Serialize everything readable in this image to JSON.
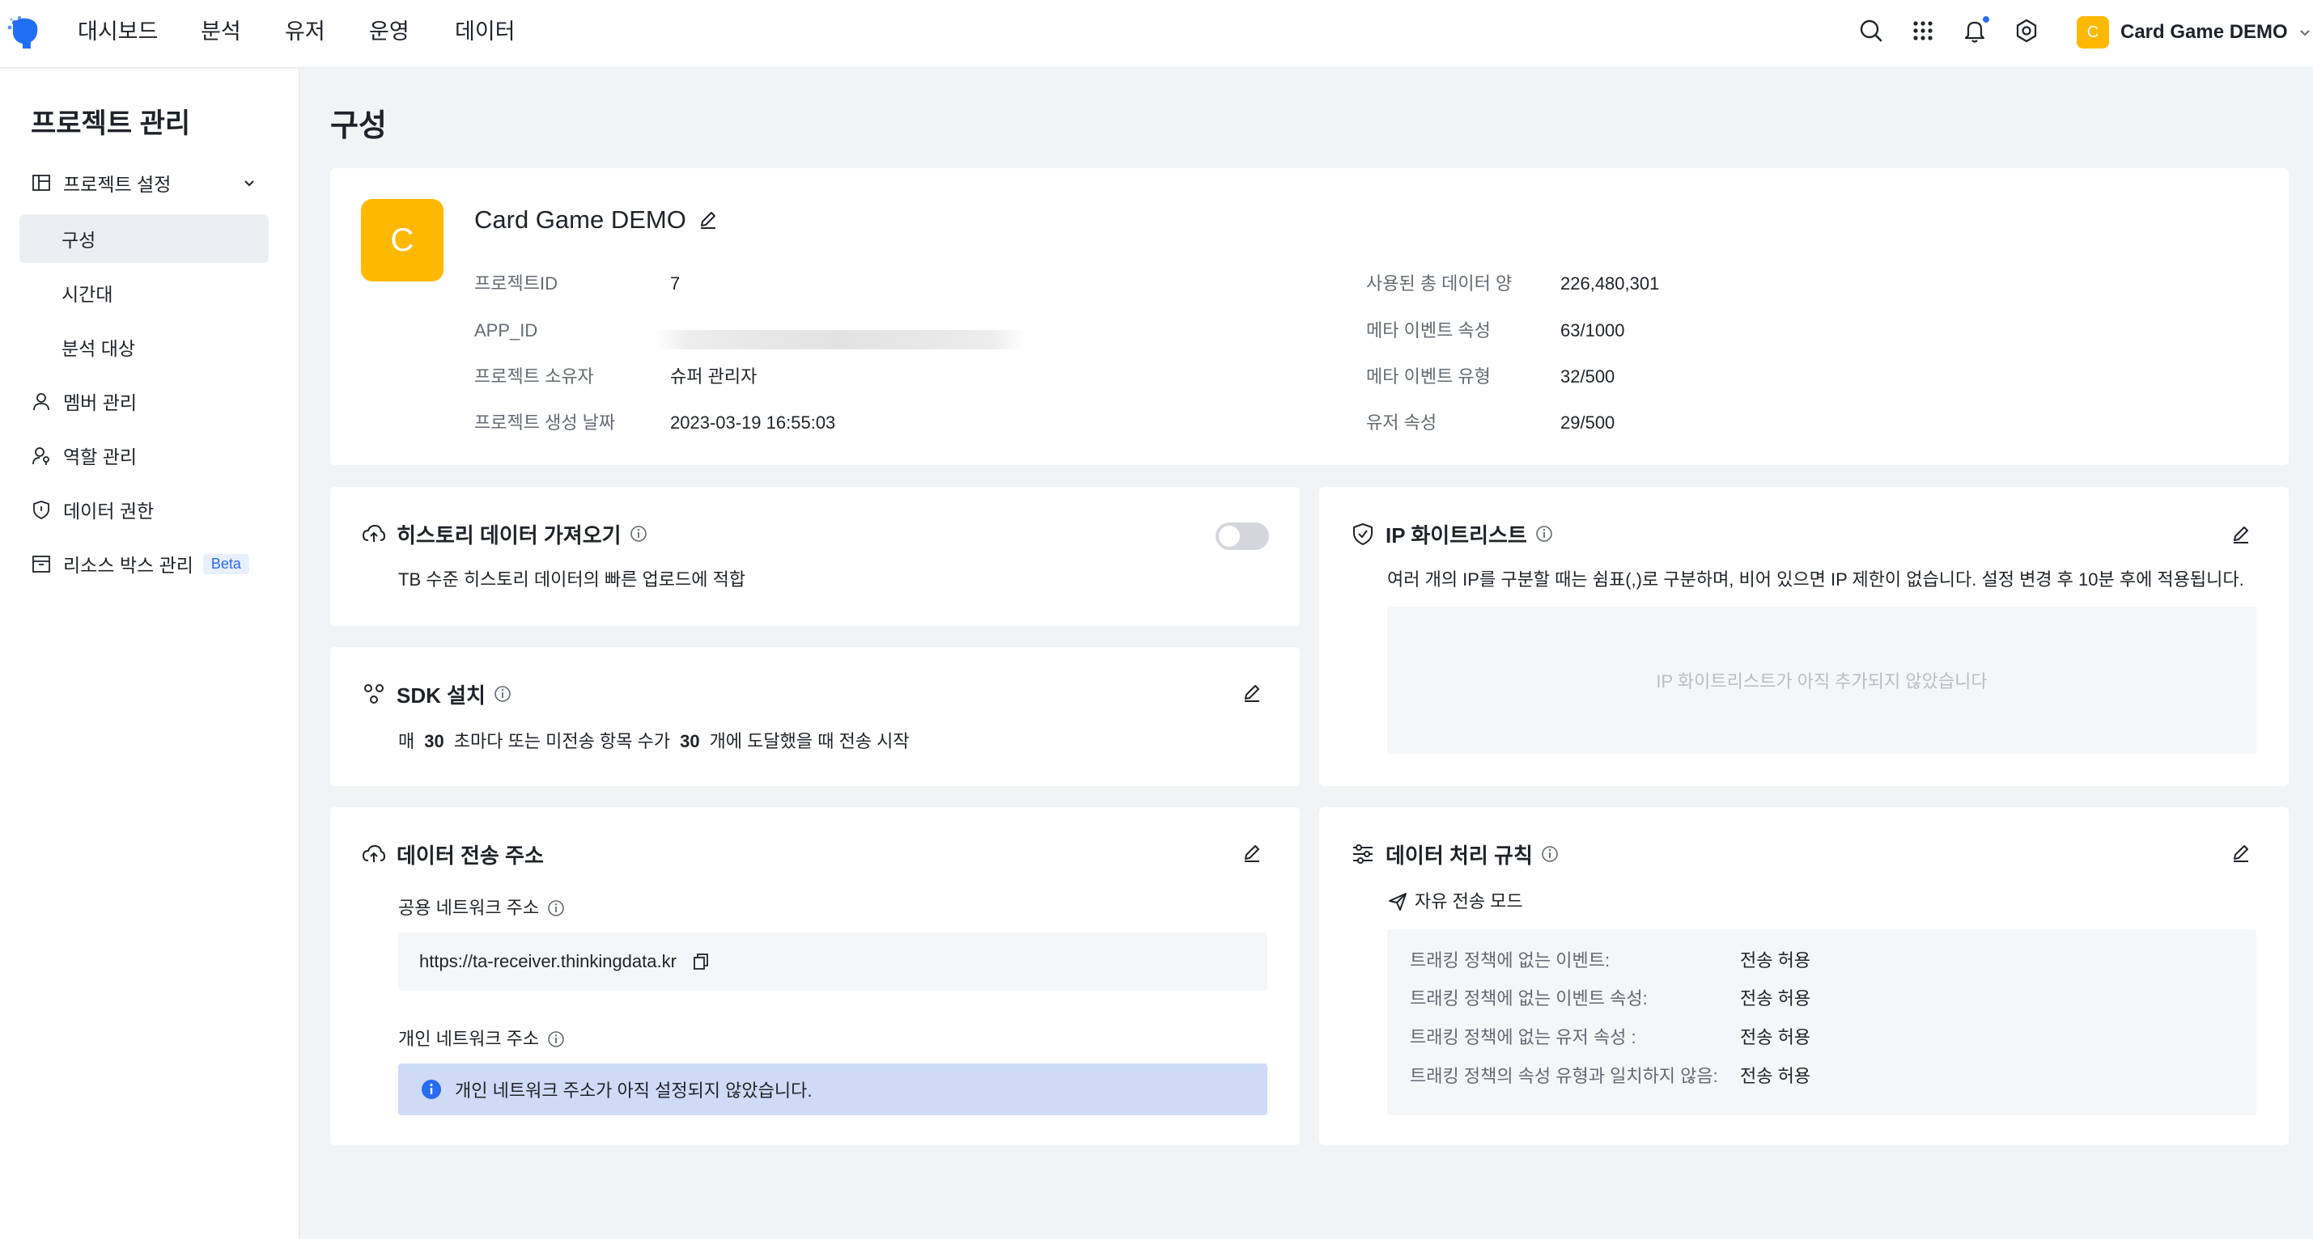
{
  "nav": {
    "items": [
      "대시보드",
      "분석",
      "유저",
      "운영",
      "데이터"
    ],
    "project_badge": "C",
    "project_name": "Card Game DEMO",
    "icons": [
      "search-icon",
      "apps-grid-icon",
      "bell-icon",
      "settings-icon"
    ]
  },
  "sidebar": {
    "title": "프로젝트 관리",
    "items": [
      {
        "label": "프로젝트 설정",
        "icon": "layout-icon"
      },
      {
        "label": "구성"
      },
      {
        "label": "시간대"
      },
      {
        "label": "분석 대상"
      },
      {
        "label": "멤버 관리",
        "icon": "user-icon"
      },
      {
        "label": "역할 관리",
        "icon": "user-key-icon"
      },
      {
        "label": "데이터 권한",
        "icon": "shield-icon"
      },
      {
        "label": "리소스 박스 관리",
        "icon": "box-icon",
        "badge": "Beta"
      }
    ]
  },
  "page": {
    "title": "구성"
  },
  "project": {
    "avatar": "C",
    "name": "Card Game DEMO",
    "left": [
      {
        "label": "프로젝트ID",
        "value": "7"
      },
      {
        "label": "APP_ID",
        "value": ""
      },
      {
        "label": "프로젝트 소유자",
        "value": "슈퍼 관리자"
      },
      {
        "label": "프로젝트 생성 날짜",
        "value": "2023-03-19 16:55:03"
      }
    ],
    "right": [
      {
        "label": "사용된 총 데이터 양",
        "value": "226,480,301"
      },
      {
        "label": "메타 이벤트 속성",
        "value": "63/1000"
      },
      {
        "label": "메타 이벤트 유형",
        "value": "32/500"
      },
      {
        "label": "유저 속성",
        "value": "29/500"
      }
    ]
  },
  "history": {
    "title": "히스토리 데이터 가져오기",
    "desc": "TB 수준 히스토리 데이터의 빠른 업로드에 적합",
    "enabled": false
  },
  "sdk": {
    "title": "SDK 설치",
    "text_1": "매",
    "interval": "30",
    "text_2": "초마다 또는 미전송 항목 수가",
    "count": "30",
    "text_3": "개에 도달했을 때 전송 시작"
  },
  "endpoint": {
    "title": "데이터 전송 주소",
    "public_label": "공용 네트워크 주소",
    "public_url": "https://ta-receiver.thinkingdata.kr",
    "private_label": "개인 네트워크 주소",
    "private_notice": "개인 네트워크 주소가 아직 설정되지 않았습니다."
  },
  "whitelist": {
    "title": "IP 화이트리스트",
    "desc": "여러 개의 IP를 구분할 때는 쉼표(,)로 구분하며, 비어 있으면 IP 제한이 없습니다. 설정 변경 후 10분 후에 적용됩니다.",
    "empty": "IP 화이트리스트가 아직 추가되지 않았습니다"
  },
  "rules": {
    "title": "데이터 처리 규칙",
    "mode": "자유 전송 모드",
    "items": [
      {
        "label": "트래킹 정책에 없는 이벤트:",
        "value": "전송 허용"
      },
      {
        "label": "트래킹 정책에 없는 이벤트 속성:",
        "value": "전송 허용"
      },
      {
        "label": "트래킹 정책에 없는 유저 속성 :",
        "value": "전송 허용"
      },
      {
        "label": "트래킹 정책의 속성 유형과 일치하지 않음:",
        "value": "전송 허용"
      }
    ]
  },
  "colors": {
    "accent": "#2a6bf2",
    "brand_badge": "#ffb800",
    "notice_bg": "#cfdaf7",
    "page_bg": "#f2f3f5"
  }
}
